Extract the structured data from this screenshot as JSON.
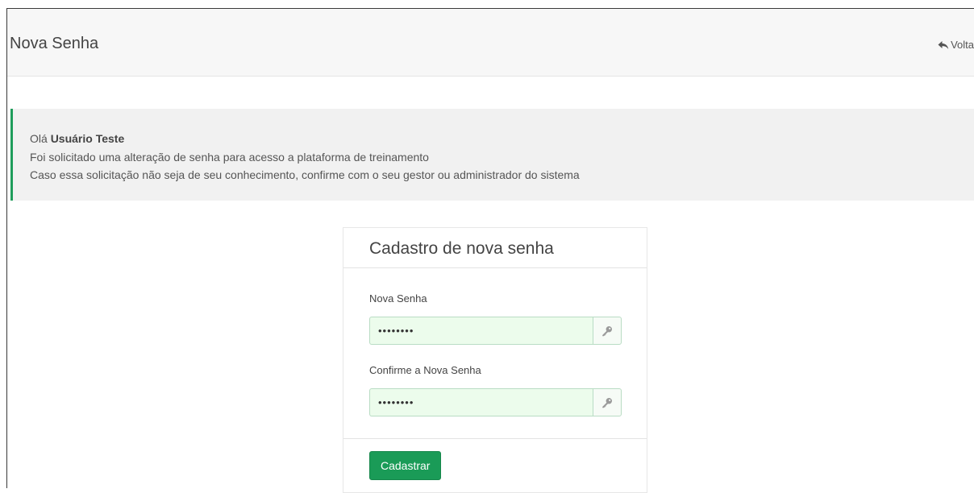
{
  "header": {
    "title": "Nova Senha",
    "back_label": "Volta"
  },
  "alert": {
    "greeting": "Olá",
    "user_name": "Usuário Teste",
    "line2": "Foi solicitado uma alteração de senha para acesso a plataforma de treinamento",
    "line3": "Caso essa solicitação não seja de seu conhecimento, confirme com o seu gestor ou administrador do sistema"
  },
  "form": {
    "title": "Cadastro de nova senha",
    "new_password": {
      "label": "Nova Senha",
      "value": "12345678"
    },
    "confirm_password": {
      "label": "Confirme a Nova Senha",
      "value": "12345678"
    },
    "submit_label": "Cadastrar"
  },
  "colors": {
    "accent_green": "#1a9b57",
    "input_background": "#ecfcec",
    "alert_border": "#1f9d5b"
  },
  "icons": {
    "back": "reply-arrow-icon",
    "password_addon": "key-icon"
  }
}
